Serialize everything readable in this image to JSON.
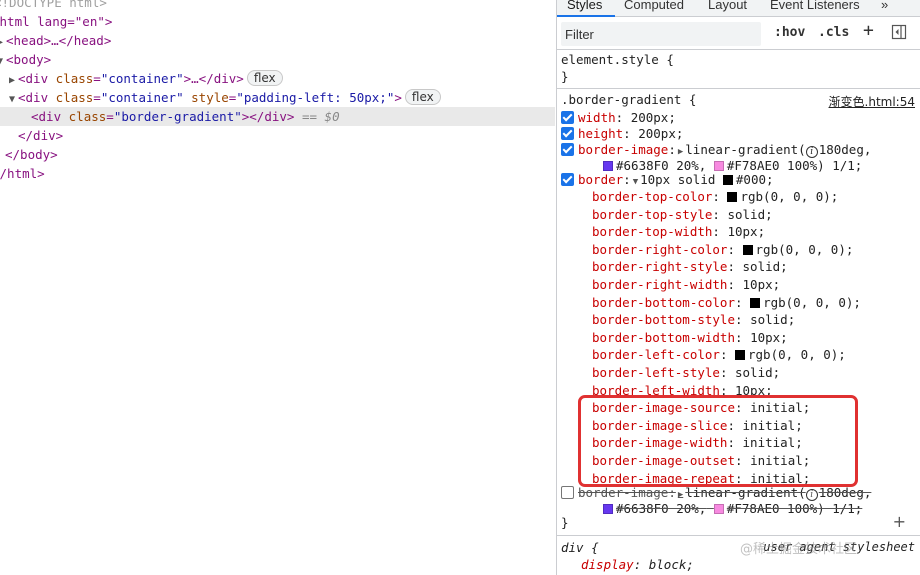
{
  "elements": {
    "doctype": "<!DOCTYPE html>",
    "html_open": "<html lang=\"en\">",
    "head": "<head>…</head>",
    "body_open": "<body>",
    "container1_open": "<div class=\"container\">",
    "container1_ellipsis": "…</div>",
    "container2_open": "<div class=\"container\" style=\"padding-left: 50px;\">",
    "flex_badge": "flex",
    "selected_open": "<div class=\"border-gradient\"></div>",
    "selected_marker": "== $0",
    "div_close": "</div>",
    "body_close": "</body>",
    "html_close": "</html>"
  },
  "tabs": [
    "Styles",
    "Computed",
    "Layout",
    "Event Listeners",
    "»"
  ],
  "toolbar": {
    "filter_placeholder": "Filter",
    "hov": ":hov",
    "cls": ".cls",
    "plus": "+",
    "toggle_icon": "sidebar-toggle-icon"
  },
  "element_style": {
    "selector": "element.style {",
    "close": "}"
  },
  "rule": {
    "selector": ".border-gradient {",
    "source": "渐变色.html:54",
    "width": {
      "name": "width",
      "value": "200px;"
    },
    "height": {
      "name": "height",
      "value": "200px;"
    },
    "border_image": {
      "name": "border-image",
      "value1": "linear-gradient(",
      "value2": "180deg,",
      "stop1": "#6638F0 20%,",
      "stop2": "#F78AE0 100%) 1/1;"
    },
    "border": {
      "name": "border",
      "value": "10px solid",
      "color": "#000;"
    },
    "longhands": [
      {
        "name": "border-top-color",
        "value": "rgb(0, 0, 0);",
        "swatch": true
      },
      {
        "name": "border-top-style",
        "value": "solid;"
      },
      {
        "name": "border-top-width",
        "value": "10px;"
      },
      {
        "name": "border-right-color",
        "value": "rgb(0, 0, 0);",
        "swatch": true
      },
      {
        "name": "border-right-style",
        "value": "solid;"
      },
      {
        "name": "border-right-width",
        "value": "10px;"
      },
      {
        "name": "border-bottom-color",
        "value": "rgb(0, 0, 0);",
        "swatch": true
      },
      {
        "name": "border-bottom-style",
        "value": "solid;"
      },
      {
        "name": "border-bottom-width",
        "value": "10px;"
      },
      {
        "name": "border-left-color",
        "value": "rgb(0, 0, 0);",
        "swatch": true
      },
      {
        "name": "border-left-style",
        "value": "solid;"
      },
      {
        "name": "border-left-width",
        "value": "10px;"
      },
      {
        "name": "border-image-source",
        "value": "initial;"
      },
      {
        "name": "border-image-slice",
        "value": "initial;"
      },
      {
        "name": "border-image-width",
        "value": "initial;"
      },
      {
        "name": "border-image-outset",
        "value": "initial;"
      },
      {
        "name": "border-image-repeat",
        "value": "initial;"
      }
    ],
    "struck": {
      "name": "border-image",
      "value1": "linear-gradient(",
      "value2": "180deg,",
      "stop1": "#6638F0 20%,",
      "stop2": "#F78AE0 100%) 1/1;"
    },
    "close": "}"
  },
  "ua_rule": {
    "selector": "div {",
    "source": "user agent stylesheet",
    "prop": "display",
    "value": "block;"
  },
  "watermark": "@稀土掘金技术社区",
  "colors": {
    "swatch_purple": "#6638F0",
    "swatch_pink": "#F78AE0",
    "swatch_black": "#000000",
    "highlight": "#e03131",
    "accent": "#1a73e8"
  }
}
